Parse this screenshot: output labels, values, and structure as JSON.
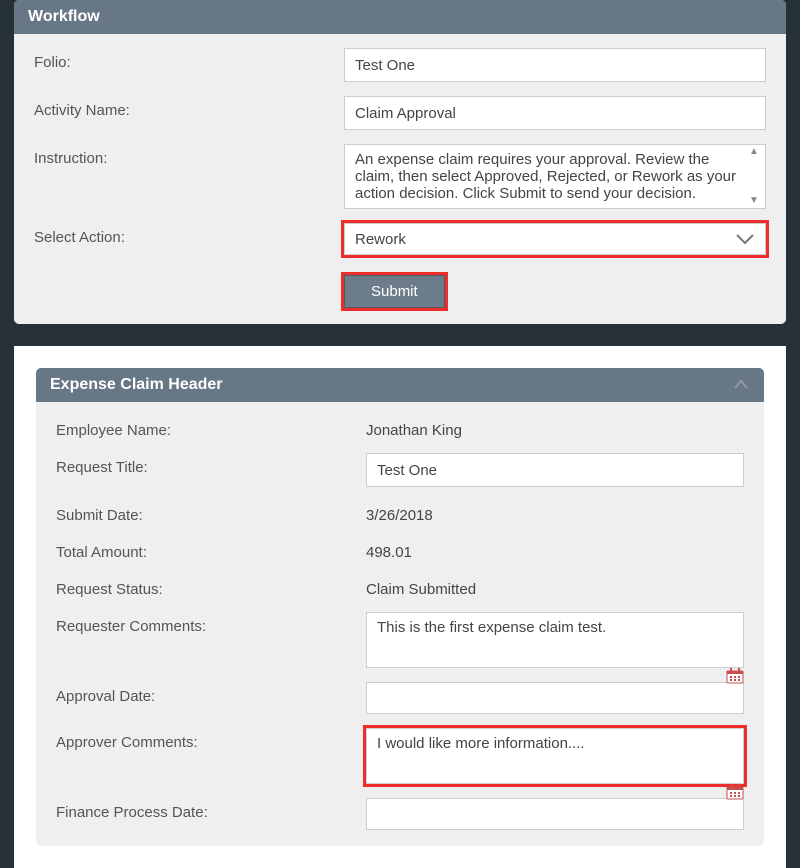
{
  "workflow": {
    "title": "Workflow",
    "folio_label": "Folio:",
    "folio_value": "Test One",
    "activity_label": "Activity Name:",
    "activity_value": "Claim Approval",
    "instruction_label": "Instruction:",
    "instruction_value": "An expense claim requires your approval. Review the claim, then select Approved, Rejected, or Rework as your action decision. Click Submit to send your decision.",
    "select_action_label": "Select Action:",
    "select_action_value": "Rework",
    "submit_label": "Submit"
  },
  "claim": {
    "title": "Expense Claim Header",
    "employee_name_label": "Employee Name:",
    "employee_name_value": "Jonathan King",
    "request_title_label": "Request Title:",
    "request_title_value": "Test One",
    "submit_date_label": "Submit Date:",
    "submit_date_value": "3/26/2018",
    "total_amount_label": "Total Amount:",
    "total_amount_value": "498.01",
    "request_status_label": "Request Status:",
    "request_status_value": "Claim Submitted",
    "requester_comments_label": "Requester Comments:",
    "requester_comments_value": "This is the first expense claim test.",
    "approval_date_label": "Approval Date:",
    "approval_date_value": "",
    "approver_comments_label": "Approver Comments:",
    "approver_comments_value": "I would like more information....",
    "finance_process_date_label": "Finance Process Date:",
    "finance_process_date_value": ""
  }
}
